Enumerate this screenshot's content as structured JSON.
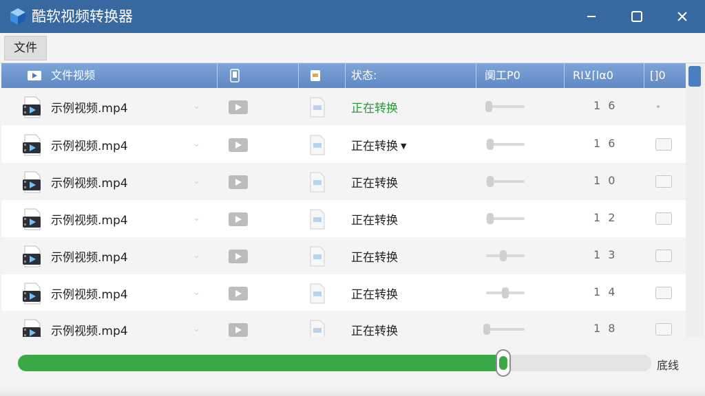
{
  "window": {
    "title": "酷软视频转换器",
    "icons": {
      "app": "cube-app-icon",
      "minimize": "minimize-icon",
      "maximize": "maximize-icon",
      "close": "close-icon"
    }
  },
  "menu": {
    "file": "文件"
  },
  "table": {
    "columns": [
      "文件视频",
      "",
      "",
      "状态:",
      "阒工P0",
      "RI⊻⌈lα0",
      "[]0"
    ],
    "rows": [
      {
        "name": "示例视频.mp4",
        "status": "正在转换",
        "status_color": "#2a9a3a",
        "value": "1 6",
        "slider": 0.05
      },
      {
        "name": "示例视频.mp4",
        "status": "正在转换",
        "status_color": "#222222",
        "value": "1 6",
        "slider": 0.1,
        "dropdown": true
      },
      {
        "name": "示例视频.mp4",
        "status": "正在转换",
        "status_color": "#222222",
        "value": "1 0",
        "slider": 0.1
      },
      {
        "name": "示例视频.mp4",
        "status": "正在转换",
        "status_color": "#222222",
        "value": "1 2",
        "slider": 0.1
      },
      {
        "name": "示例视频.mp4",
        "status": "正在转换",
        "status_color": "#222222",
        "value": "1 3",
        "slider": 0.45
      },
      {
        "name": "示例视频.mp4",
        "status": "正在转换",
        "status_color": "#222222",
        "value": "1 4",
        "slider": 0.5
      },
      {
        "name": "示例视频.mp4",
        "status": "正在转换",
        "status_color": "#222222",
        "value": "1 8",
        "slider": 0.0
      }
    ]
  },
  "progress": {
    "value": 0.766,
    "label": "底线",
    "color": "#3aa844"
  },
  "colors": {
    "titlebar": "#37689f",
    "header": "#5f89c5",
    "accent": "#3aa844"
  }
}
